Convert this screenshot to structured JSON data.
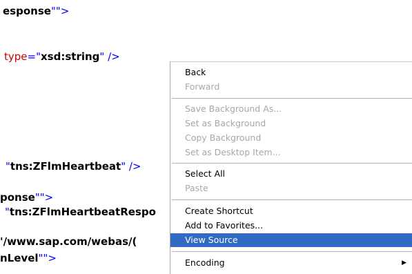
{
  "xml_source": {
    "lines": [
      {
        "pre": "esponse",
        "q1": "\"",
        "q2": "\"",
        "post": ">",
        "attr": "",
        "eq": "",
        "val": ""
      },
      {
        "pre": "",
        "attr": "type",
        "eq": "=",
        "q1": "\"",
        "val": "xsd:string",
        "q2": "\"",
        "post": " />"
      },
      {
        "pre": "",
        "attr": "",
        "eq": "",
        "q1": "\"",
        "val": "tns:ZFlmHeartbeat",
        "q2": "\"",
        "post": " />"
      },
      {
        "pre": "ponse",
        "q1": "\"",
        "q2": "\"",
        "post": ">",
        "attr": "",
        "eq": "",
        "val": ""
      },
      {
        "pre": "",
        "attr": "",
        "eq": "",
        "q1": "\"",
        "val": "tns:ZFlmHeartbeatRespo",
        "q2": "",
        "post": ""
      },
      {
        "pre": "'/www.sap.com/webas/(",
        "attr": "",
        "eq": "",
        "q1": "",
        "val": "",
        "q2": "",
        "post": ""
      },
      {
        "pre": "nLevel",
        "q1": "\"",
        "q2": "\"",
        "post": ">",
        "attr": "",
        "eq": "",
        "val": ""
      }
    ]
  },
  "context_menu": {
    "items": [
      {
        "label": "Back",
        "enabled": true
      },
      {
        "label": "Forward",
        "enabled": false
      },
      {
        "label": "Save Background As...",
        "enabled": false
      },
      {
        "label": "Set as Background",
        "enabled": false
      },
      {
        "label": "Copy Background",
        "enabled": false
      },
      {
        "label": "Set as Desktop Item...",
        "enabled": false
      },
      {
        "label": "Select All",
        "enabled": true
      },
      {
        "label": "Paste",
        "enabled": false
      },
      {
        "label": "Create Shortcut",
        "enabled": true
      },
      {
        "label": "Add to Favorites...",
        "enabled": true
      },
      {
        "label": "View Source",
        "enabled": true,
        "highlighted": true
      },
      {
        "label": "Encoding",
        "enabled": true,
        "submenu": true
      }
    ],
    "submenu_arrow": "▶"
  },
  "colors": {
    "highlight": "#316ac5",
    "disabled_text": "#a7a6aa",
    "xml_quote": "#0000ff",
    "xml_attr": "#cc0000"
  }
}
